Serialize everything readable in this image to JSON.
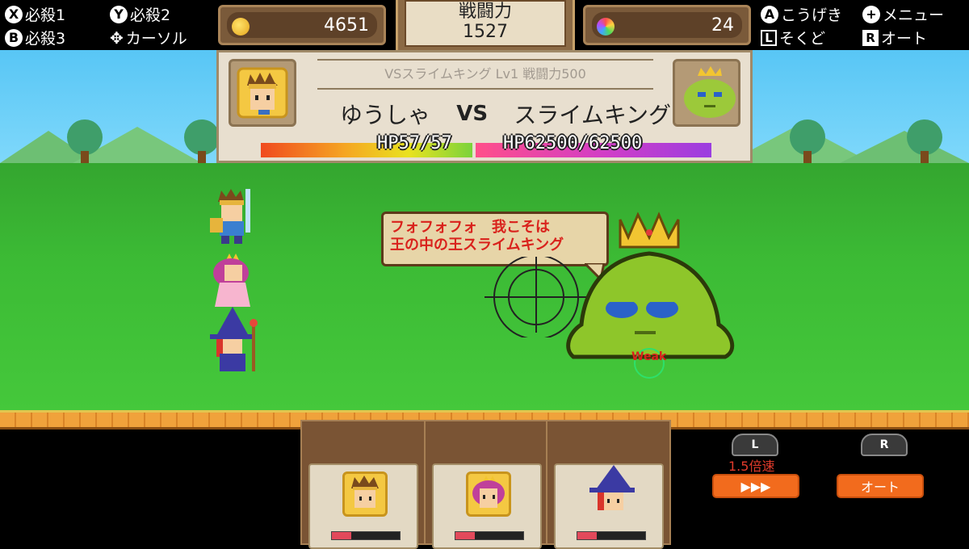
{
  "controls": {
    "x_label": "必殺1",
    "y_label": "必殺2",
    "b_label": "必殺3",
    "dpad_label": "カーソル",
    "a_label": "こうげき",
    "plus_label": "メニュー",
    "l_label": "そくど",
    "r_label": "オート",
    "x_key": "X",
    "y_key": "Y",
    "b_key": "B",
    "a_key": "A",
    "plus_key": "+",
    "l_key": "L",
    "r_key": "R"
  },
  "header": {
    "gold": "4651",
    "power_title": "戦闘力",
    "power_value": "1527",
    "gems": "24"
  },
  "battle": {
    "subtitle": "VSスライムキング Lv1 戦闘力500",
    "hero_name": "ゆうしゃ",
    "vs": "VS",
    "enemy_name": "スライムキング",
    "hero_hp": "HP57/57",
    "enemy_hp": "HP62500/62500",
    "hero_hp_fraction": 1.0,
    "enemy_hp_fraction": 1.0
  },
  "speech": {
    "line1": "フォフォフォ　我こそは",
    "line2": "王の中の王スライムキング"
  },
  "enemy": {
    "weak_label": "Weak"
  },
  "speed": {
    "l_key": "L",
    "r_key": "R",
    "speed_label": "1.5倍速",
    "fast_button": "▶▶▶",
    "auto_button": "オート"
  },
  "party": [
    {
      "name": "hero",
      "hp_fraction": 0.28
    },
    {
      "name": "princess",
      "hp_fraction": 0.28
    },
    {
      "name": "witch",
      "hp_fraction": 0.28
    }
  ],
  "colors": {
    "accent_orange": "#f26b1d",
    "enemy_green": "#8ec62a",
    "speech_text": "#d9221c"
  }
}
